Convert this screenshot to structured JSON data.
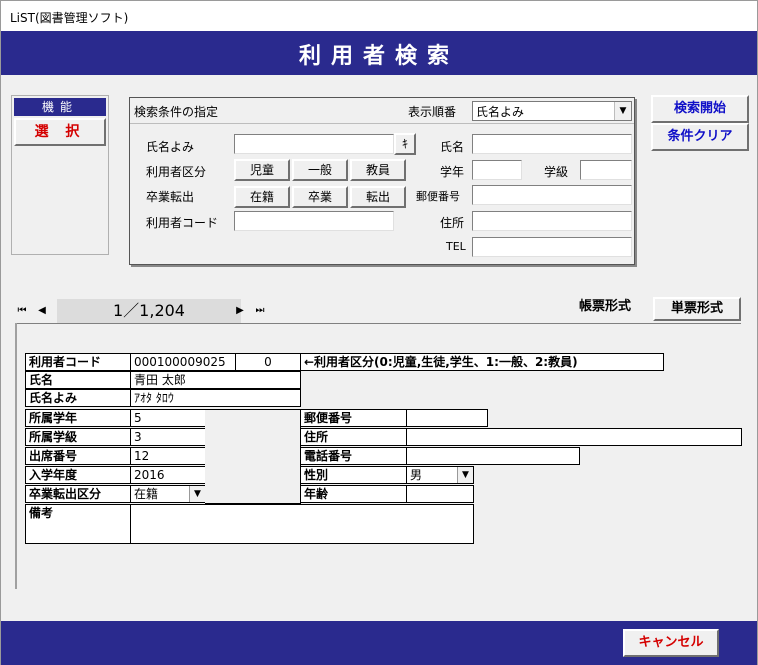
{
  "window": {
    "title": "LiST(図書管理ソフト)"
  },
  "header": {
    "title": "利用者検索"
  },
  "function_panel": {
    "header": "機能",
    "select_label": "選 択"
  },
  "search_panel": {
    "title": "検索条件の指定",
    "sort_label": "表示順番",
    "sort_value": "氏名よみ",
    "name_kana_label": "氏名よみ",
    "name_kana_value": "",
    "kana_button": "ｷ",
    "name_label": "氏名",
    "name_value": "",
    "user_type_label": "利用者区分",
    "user_type_buttons": [
      "児童",
      "一般",
      "教員"
    ],
    "grade_label": "学年",
    "class_label": "学級",
    "status_label": "卒業転出",
    "status_buttons": [
      "在籍",
      "卒業",
      "転出"
    ],
    "postal_label": "郵便番号",
    "user_code_label": "利用者コード",
    "address_label": "住所",
    "tel_label": "TEL"
  },
  "actions": {
    "search_start": "検索開始",
    "clear_conditions": "条件クリア",
    "cancel": "キャンセル"
  },
  "navigator": {
    "record_text": "1／1,204"
  },
  "view_modes": {
    "list": "帳票形式",
    "single": "単票形式"
  },
  "record": {
    "user_code_label": "利用者コード",
    "user_code_value": "000100009025",
    "user_type_value": "0",
    "user_type_note": "←利用者区分(0:児童,生徒,学生、1:一般、2:教員)",
    "name_label": "氏名",
    "name_value": "青田 太郎",
    "name_kana_label": "氏名よみ",
    "name_kana_value": "ｱｵﾀ ﾀﾛｳ",
    "grade_label": "所属学年",
    "grade_value": "5",
    "class_label": "所属学級",
    "class_value": "3",
    "attendance_label": "出席番号",
    "attendance_value": "12",
    "entry_year_label": "入学年度",
    "entry_year_value": "2016",
    "status_label": "卒業転出区分",
    "status_value": "在籍",
    "postal_label": "郵便番号",
    "postal_value": "",
    "address_label": "住所",
    "address_value": "",
    "phone_label": "電話番号",
    "phone_value": "",
    "gender_label": "性別",
    "gender_value": "男",
    "age_label": "年齢",
    "age_value": "",
    "notes_label": "備考",
    "notes_value": ""
  },
  "colors": {
    "banner": "#2a2a8e",
    "accent_red": "#d40000",
    "accent_blue": "#1010c8"
  }
}
